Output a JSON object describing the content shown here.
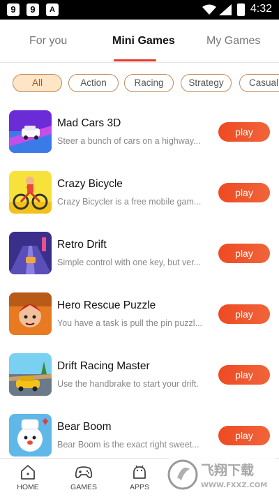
{
  "status_bar": {
    "time": "4:32",
    "icons": [
      "notification-9-icon",
      "notification-9-icon",
      "font-icon",
      "wifi-icon",
      "signal-icon",
      "battery-charging-icon"
    ]
  },
  "tabs": [
    {
      "label": "For you",
      "active": false
    },
    {
      "label": "Mini Games",
      "active": true
    },
    {
      "label": "My Games",
      "active": false
    }
  ],
  "filters": [
    {
      "label": "All",
      "active": true
    },
    {
      "label": "Action",
      "active": false
    },
    {
      "label": "Racing",
      "active": false
    },
    {
      "label": "Strategy",
      "active": false
    },
    {
      "label": "Casual",
      "active": false
    }
  ],
  "games": [
    {
      "title": "Mad Cars 3D",
      "description": "Steer a bunch of cars on a highway...",
      "button": "play",
      "icon": "mad-cars-thumbnail"
    },
    {
      "title": "Crazy Bicycle",
      "description": "Crazy Bicycler is a free mobile gam...",
      "button": "play",
      "icon": "crazy-bicycle-thumbnail"
    },
    {
      "title": "Retro Drift",
      "description": "Simple control with one key, but ver...",
      "button": "play",
      "icon": "retro-drift-thumbnail"
    },
    {
      "title": "Hero Rescue Puzzle",
      "description": "You have a task is pull the pin puzzl...",
      "button": "play",
      "icon": "hero-rescue-thumbnail"
    },
    {
      "title": "Drift Racing Master",
      "description": "Use the handbrake to start your drift.",
      "button": "play",
      "icon": "drift-racing-thumbnail"
    },
    {
      "title": "Bear Boom",
      "description": "Bear Boom is the exact right sweet...",
      "button": "play",
      "icon": "bear-boom-thumbnail"
    }
  ],
  "bottom_nav": [
    {
      "label": "HOME",
      "icon": "home-icon"
    },
    {
      "label": "GAMES",
      "icon": "gamepad-icon"
    },
    {
      "label": "APPS",
      "icon": "android-icon"
    }
  ],
  "watermark": {
    "text": "飞翔下载",
    "url_text": "WWW.FXXZ.COM"
  },
  "colors": {
    "accent": "#e8352a",
    "play_button": "#ef4a22",
    "chip_border": "#c48a5a",
    "chip_active_bg": "#fde5c6"
  }
}
